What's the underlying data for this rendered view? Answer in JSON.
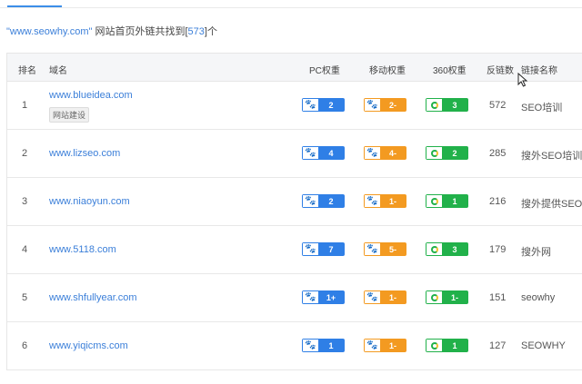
{
  "summary": {
    "site": "\"www.seowhy.com\"",
    "text_before_count": " 网站首页外链共找到[",
    "count": "573",
    "text_after_count": "]个"
  },
  "table": {
    "headers": {
      "rank": "排名",
      "domain": "域名",
      "pc": "PC权重",
      "mobile": "移动权重",
      "q360": "360权重",
      "backlinks": "反链数",
      "anchor": "链接名称"
    },
    "rows": [
      {
        "rank": "1",
        "domain": "www.blueidea.com",
        "tag": "网站建设",
        "pc": "2",
        "mobile": "2-",
        "q360": "3",
        "backlinks": "572",
        "anchor": "SEO培训"
      },
      {
        "rank": "2",
        "domain": "www.lizseo.com",
        "tag": "",
        "pc": "4",
        "mobile": "4-",
        "q360": "2",
        "backlinks": "285",
        "anchor": "搜外SEO培训"
      },
      {
        "rank": "3",
        "domain": "www.niaoyun.com",
        "tag": "",
        "pc": "2",
        "mobile": "1-",
        "q360": "1",
        "backlinks": "216",
        "anchor": "搜外提供SEO..."
      },
      {
        "rank": "4",
        "domain": "www.5118.com",
        "tag": "",
        "pc": "7",
        "mobile": "5-",
        "q360": "3",
        "backlinks": "179",
        "anchor": "搜外网"
      },
      {
        "rank": "5",
        "domain": "www.shfullyear.com",
        "tag": "",
        "pc": "1+",
        "mobile": "1-",
        "q360": "1-",
        "backlinks": "151",
        "anchor": "seowhy"
      },
      {
        "rank": "6",
        "domain": "www.yiqicms.com",
        "tag": "",
        "pc": "1",
        "mobile": "1-",
        "q360": "1",
        "backlinks": "127",
        "anchor": "SEOWHY"
      }
    ]
  },
  "icons": {
    "pc": "baidu-paw-icon",
    "mobile": "baidu-paw-icon",
    "q360": "360-ring-icon"
  },
  "colors": {
    "link": "#3b7fd9",
    "pc": "#2f7fe6",
    "mobile": "#f39a21",
    "q360": "#21b14a"
  }
}
